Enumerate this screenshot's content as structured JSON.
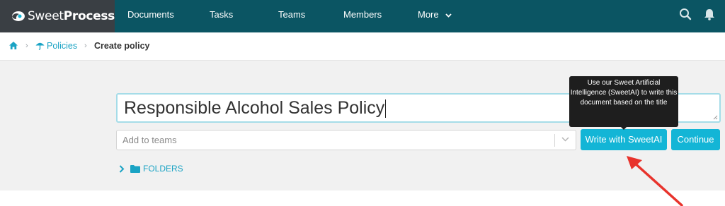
{
  "brand": {
    "name_light": "Sweet",
    "name_bold": "Process"
  },
  "nav": {
    "documents": "Documents",
    "tasks": "Tasks",
    "teams": "Teams",
    "members": "Members",
    "more": "More"
  },
  "breadcrumb": {
    "policies": "Policies",
    "current": "Create policy"
  },
  "form": {
    "title_value": "Responsible Alcohol Sales Policy",
    "teams_placeholder": "Add to teams",
    "sweetai_button": "Write with SweetAI",
    "continue_button": "Continue",
    "folders_label": "FOLDERS"
  },
  "tooltip": {
    "text": "Use our Sweet Artificial Intelligence (SweetAI) to write this document based on the title"
  },
  "colors": {
    "navbar": "#0b5563",
    "logo_bg": "#3a3f44",
    "accent": "#13b5d6",
    "link": "#1aa3c4",
    "annotation_arrow": "#e8332c"
  },
  "icons": [
    "sweetprocess-logo-icon",
    "search-icon",
    "bell-icon",
    "home-icon",
    "umbrella-icon",
    "chevron-down-icon",
    "chevron-right-icon",
    "folder-icon",
    "resize-handle-icon"
  ]
}
